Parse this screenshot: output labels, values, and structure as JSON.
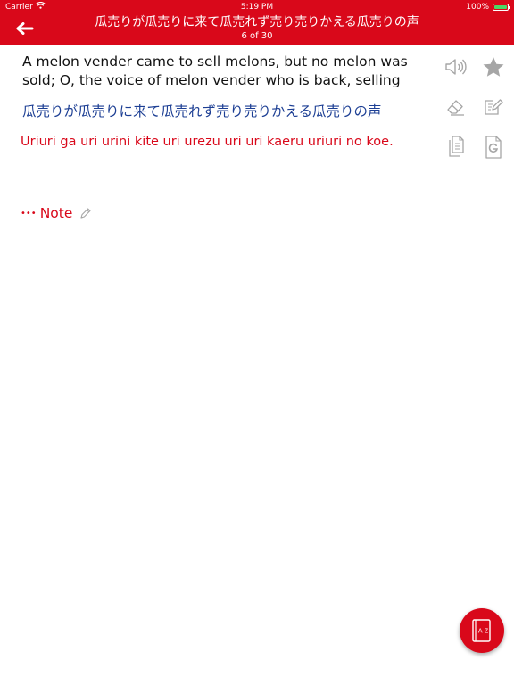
{
  "status_bar": {
    "carrier": "Carrier",
    "time": "5:19 PM",
    "battery": "100%",
    "battery_level": 1.0
  },
  "nav": {
    "title": "瓜売りが瓜売りに来て瓜売れず売り売りかえる瓜売りの声",
    "subtitle": "6 of 30"
  },
  "entry": {
    "english": "A melon vender came to sell melons, but no melon was sold; O, the voice of melon vender who is back, selling",
    "japanese": "瓜売りが瓜売りに来て瓜売れず売り売りかえる瓜売りの声",
    "romaji": "Uriuri ga uri urini kite uri urezu uri uri kaeru uriuri no koe."
  },
  "note": {
    "dots": "•••",
    "label": "Note"
  },
  "fab": {
    "label": "A-Z"
  },
  "colors": {
    "accent": "#d9081a",
    "japanese_text": "#1d3f94",
    "icon_gray": "#a6a6a6"
  },
  "icons": [
    "back-arrow-icon",
    "wifi-icon",
    "battery-icon",
    "speaker-icon",
    "star-icon",
    "eraser-icon",
    "edit-icon",
    "copy-icon",
    "google-icon",
    "pencil-icon",
    "dictionary-icon"
  ]
}
